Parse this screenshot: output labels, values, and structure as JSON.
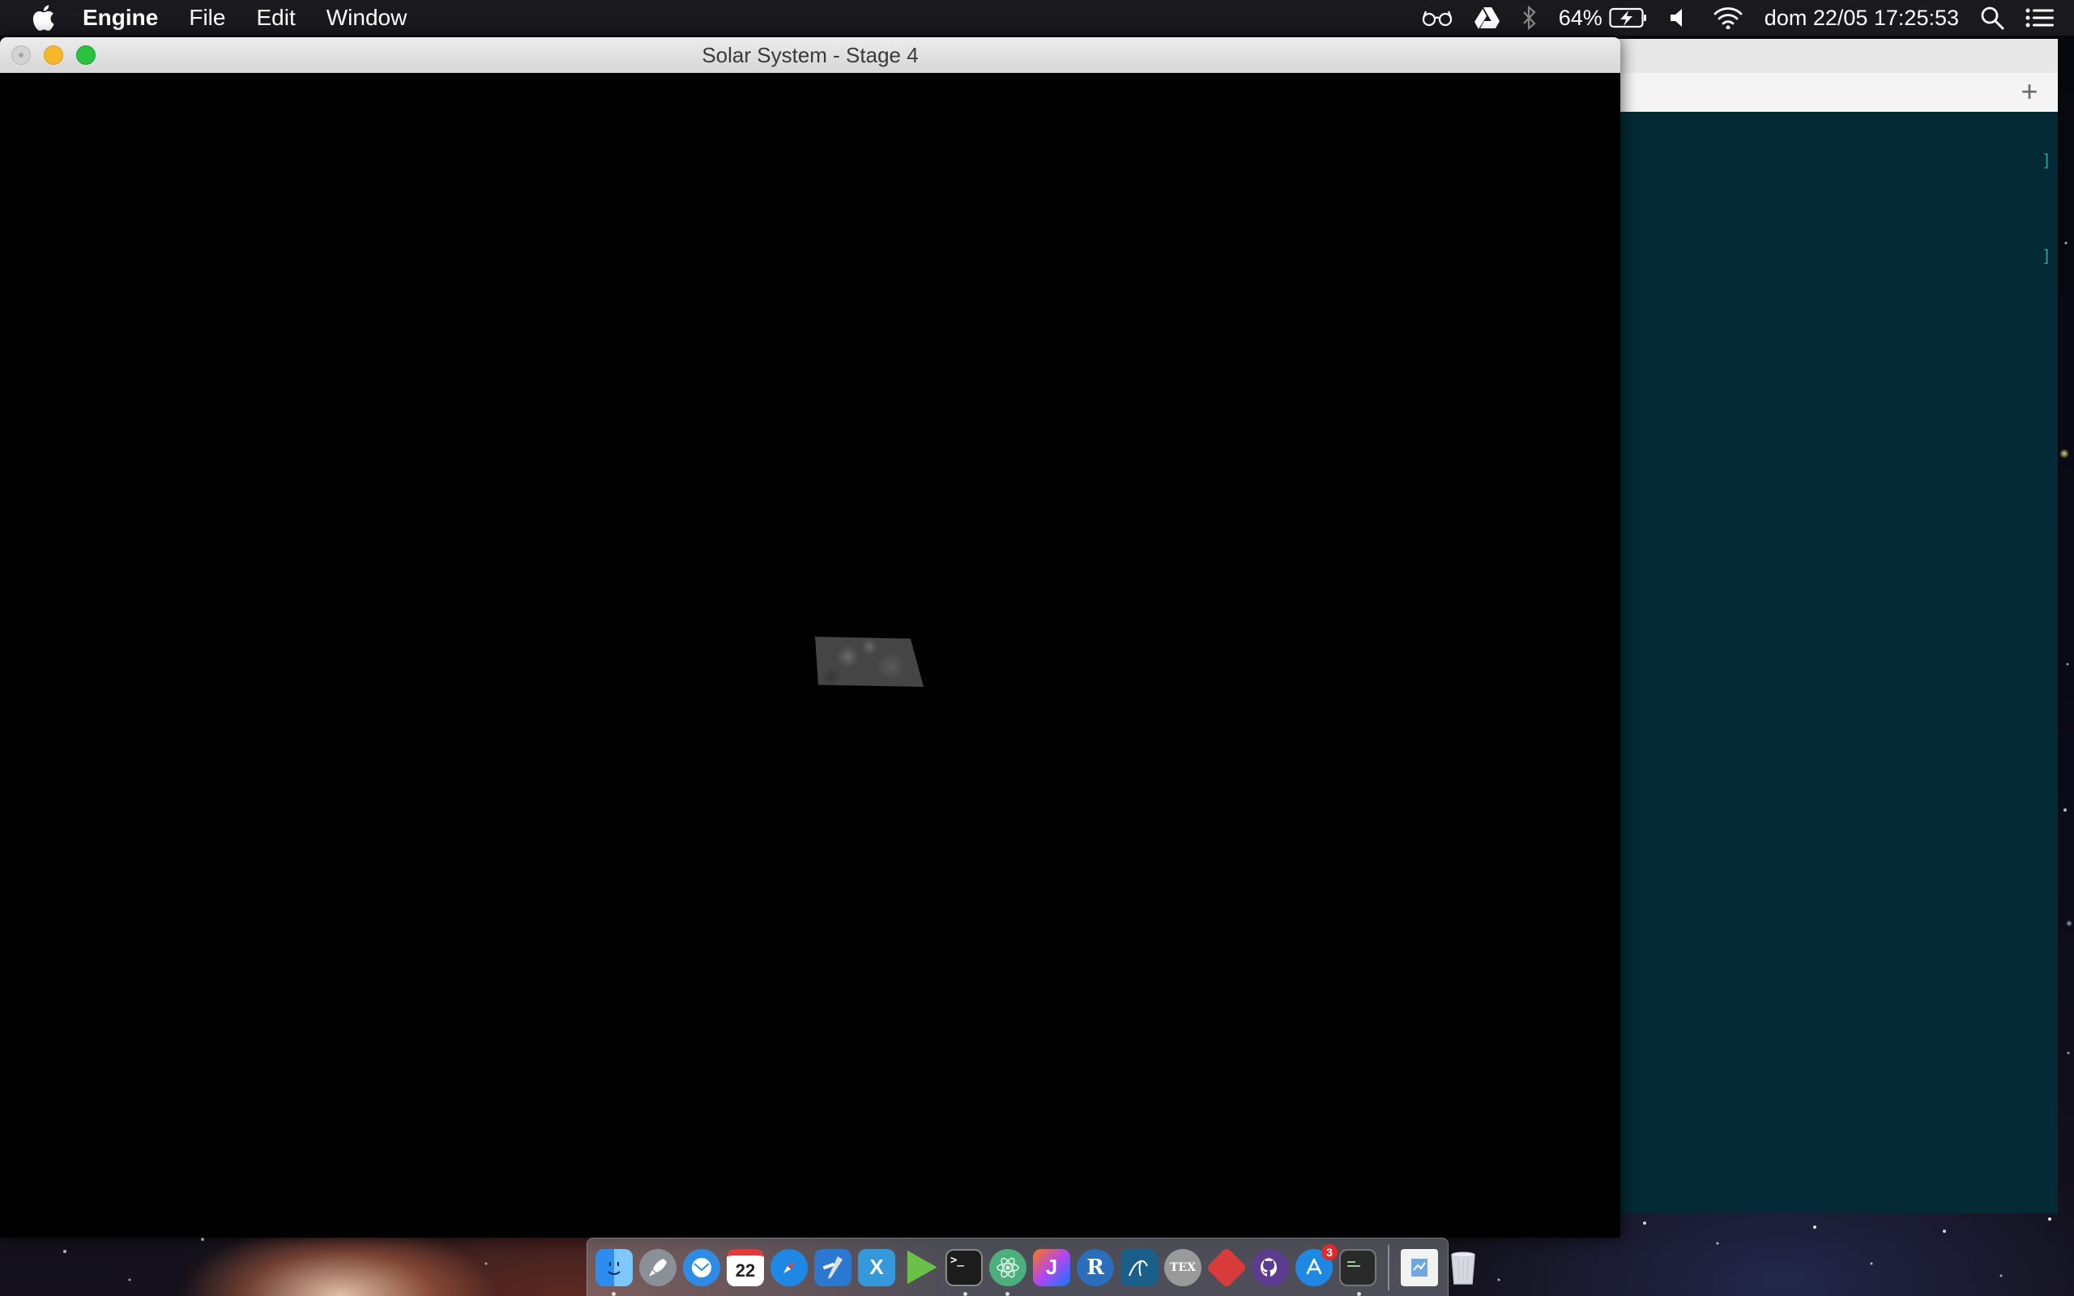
{
  "menubar": {
    "app_name": "Engine",
    "menus": [
      "File",
      "Edit",
      "Window"
    ],
    "status": {
      "battery_percent": "64%",
      "datetime": "dom 22/05  17:25:53"
    }
  },
  "window": {
    "title": "Solar System - Stage 4",
    "viewport_bg": "#000000"
  },
  "background_window": {
    "new_tab_label": "+",
    "content_bg": "#042a35",
    "bracket_marks": [
      "]",
      "]"
    ]
  },
  "dock": {
    "items": [
      {
        "name": "finder",
        "running": true
      },
      {
        "name": "launchpad",
        "running": false
      },
      {
        "name": "mail",
        "running": false
      },
      {
        "name": "calendar",
        "label": "22",
        "running": false
      },
      {
        "name": "safari",
        "running": false
      },
      {
        "name": "xcode",
        "running": false
      },
      {
        "name": "xamarin",
        "label": "X",
        "running": false
      },
      {
        "name": "infuse",
        "running": false
      },
      {
        "name": "terminal",
        "label": ">_",
        "running": true
      },
      {
        "name": "atom",
        "running": true
      },
      {
        "name": "intellij",
        "label": "J",
        "running": false
      },
      {
        "name": "r",
        "label": "R",
        "running": false
      },
      {
        "name": "mysql-workbench",
        "running": false
      },
      {
        "name": "tex",
        "label": "TEX",
        "running": false
      },
      {
        "name": "git-tool",
        "running": false
      },
      {
        "name": "github",
        "running": false
      },
      {
        "name": "app-store",
        "badge": "3",
        "running": false
      },
      {
        "name": "console",
        "running": true
      },
      {
        "name": "downloads-stack",
        "running": false
      },
      {
        "name": "trash",
        "running": false
      }
    ]
  }
}
